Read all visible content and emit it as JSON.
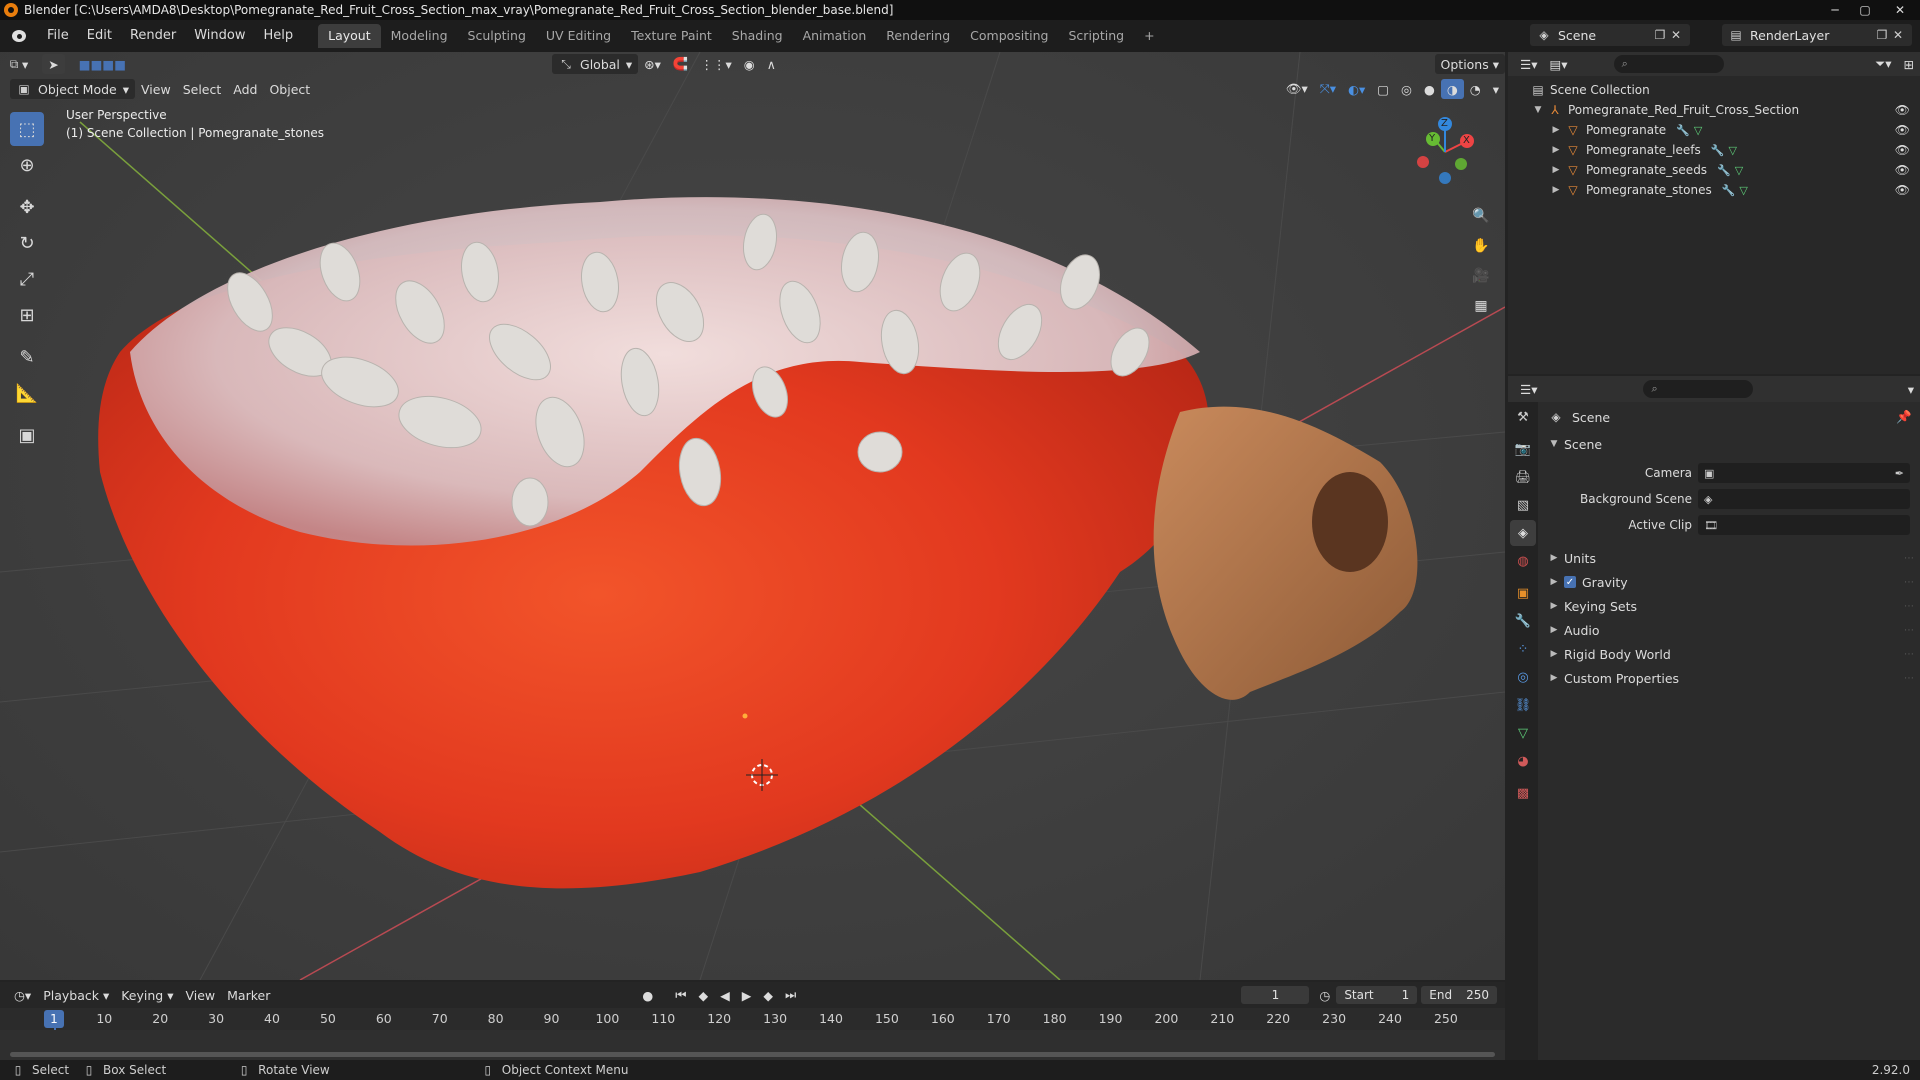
{
  "titlebar": {
    "title": "Blender [C:\\Users\\AMDA8\\Desktop\\Pomegranate_Red_Fruit_Cross_Section_max_vray\\Pomegranate_Red_Fruit_Cross_Section_blender_base.blend]",
    "minimize": "─",
    "maximize": "▢",
    "close": "✕"
  },
  "menus": [
    "File",
    "Edit",
    "Render",
    "Window",
    "Help"
  ],
  "workspaces": [
    "Layout",
    "Modeling",
    "Sculpting",
    "UV Editing",
    "Texture Paint",
    "Shading",
    "Animation",
    "Rendering",
    "Compositing",
    "Scripting"
  ],
  "workspace_add": "+",
  "scene": {
    "name": "Scene",
    "render_layer": "RenderLayer"
  },
  "viewport": {
    "header": {
      "mode": "Object Mode",
      "menus": [
        "View",
        "Select",
        "Add",
        "Object"
      ],
      "transform_orientation": "Global",
      "options": "Options"
    },
    "info_line1": "User Perspective",
    "info_line2": "(1) Scene Collection | Pomegranate_stones",
    "gizmo": {
      "x": "X",
      "y": "Y",
      "z": "Z"
    }
  },
  "outliner": {
    "root": "Scene Collection",
    "collection": "Pomegranate_Red_Fruit_Cross_Section",
    "objects": [
      "Pomegranate",
      "Pomegranate_leefs",
      "Pomegranate_seeds",
      "Pomegranate_stones"
    ]
  },
  "properties": {
    "context": "Scene",
    "panel_title": "Scene",
    "fields": [
      {
        "label": "Camera"
      },
      {
        "label": "Background Scene"
      },
      {
        "label": "Active Clip"
      }
    ],
    "subpanels": [
      "Units",
      "Gravity",
      "Keying Sets",
      "Audio",
      "Rigid Body World",
      "Custom Properties"
    ],
    "gravity_checked": "✓"
  },
  "timeline": {
    "menus": [
      "Playback",
      "Keying",
      "View",
      "Marker"
    ],
    "current_frame": "1",
    "start_label": "Start",
    "start": "1",
    "end_label": "End",
    "end": "250",
    "ruler": [
      "10",
      "20",
      "30",
      "40",
      "50",
      "60",
      "70",
      "80",
      "90",
      "100",
      "110",
      "120",
      "130",
      "140",
      "150",
      "160",
      "170",
      "180",
      "190",
      "200",
      "210",
      "220",
      "230",
      "240",
      "250"
    ],
    "playhead": "1"
  },
  "statusbar": {
    "select": "Select",
    "box_select": "Box Select",
    "rotate_view": "Rotate View",
    "context_menu": "Object Context Menu",
    "version": "2.92.0"
  }
}
